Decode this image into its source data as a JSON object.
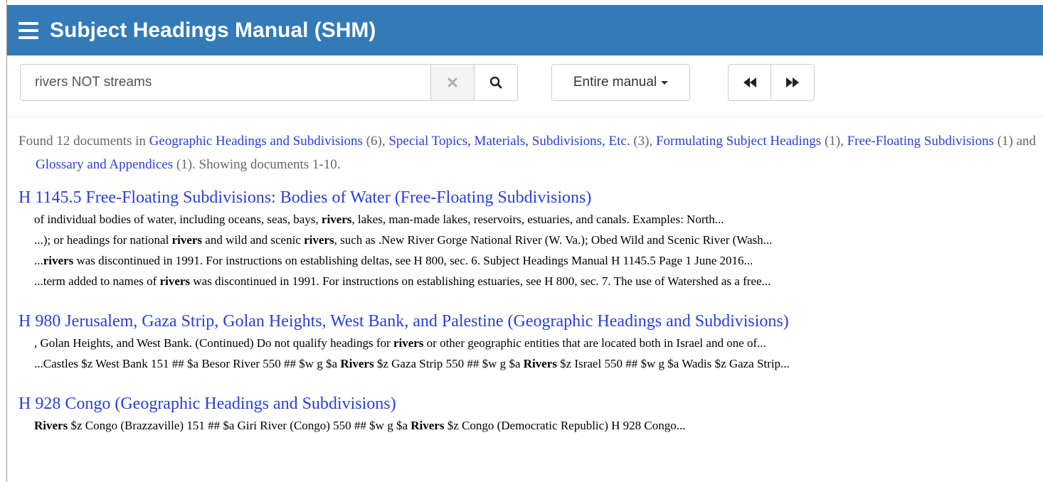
{
  "header": {
    "title": "Subject Headings Manual (SHM)"
  },
  "search": {
    "value": "rivers NOT streams"
  },
  "scope": {
    "label": "Entire manual"
  },
  "summary": {
    "prefix": "Found 12 documents in ",
    "categories": [
      {
        "label": "Geographic Headings and Subdivisions",
        "count": "(6)"
      },
      {
        "label": "Special Topics, Materials, Subdivisions, Etc.",
        "count": "(3)"
      },
      {
        "label": "Formulating Subject Headings",
        "count": "(1)"
      },
      {
        "label": "Free-Floating Subdivisions",
        "count": "(1)"
      },
      {
        "label": "Glossary and Appendices",
        "count": "(1)"
      }
    ],
    "and_word": "and",
    "suffix": ". Showing documents 1-10."
  },
  "results": [
    {
      "title": "H 1145.5 Free-Floating Subdivisions: Bodies of Water (Free-Floating Subdivisions)",
      "snippets": [
        [
          "of individual bodies of water, including oceans, seas, bays, ",
          "rivers",
          ", lakes, man-made lakes, reservoirs, estuaries, and canals. Examples: North..."
        ],
        [
          "...); or headings for national ",
          "rivers",
          " and wild and scenic ",
          "rivers",
          ", such as .New River Gorge National River (W. Va.); Obed Wild and Scenic River (Wash..."
        ],
        [
          "...",
          "rivers",
          " was discontinued in 1991. For instructions on establishing deltas, see H 800, sec. 6. Subject Headings Manual H 1145.5 Page 1 June 2016..."
        ],
        [
          "...term added to names of ",
          "rivers",
          " was discontinued in 1991. For instructions on establishing estuaries, see H 800, sec. 7. The use of Watershed as a free..."
        ]
      ]
    },
    {
      "title": "H 980 Jerusalem, Gaza Strip, Golan Heights, West Bank, and Palestine (Geographic Headings and Subdivisions)",
      "snippets": [
        [
          ", Golan Heights, and West Bank. (Continued) Do not qualify headings for ",
          "rivers",
          " or other geographic entities that are located both in Israel and one of..."
        ],
        [
          "...Castles $z West Bank 151 ## $a Besor River 550 ## $w g $a ",
          "Rivers",
          " $z Gaza Strip 550 ## $w g $a ",
          "Rivers",
          " $z Israel 550 ## $w g $a Wadis $z Gaza Strip..."
        ]
      ]
    },
    {
      "title": "H 928 Congo (Geographic Headings and Subdivisions)",
      "snippets": [
        [
          "",
          "Rivers",
          " $z Congo (Brazzaville) 151 ## $a Giri River (Congo) 550 ## $w g $a ",
          "Rivers",
          " $z Congo (Democratic Republic) H 928 Congo..."
        ]
      ]
    }
  ]
}
